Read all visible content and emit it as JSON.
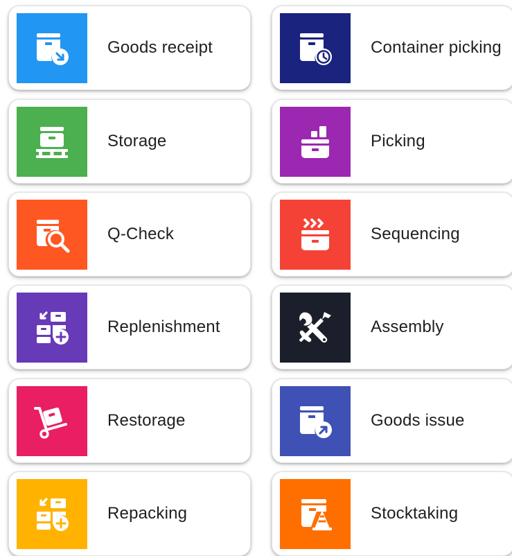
{
  "tiles": [
    {
      "label": "Goods receipt",
      "icon": "container-arrow-in-icon",
      "color": "#2196f3"
    },
    {
      "label": "Container picking",
      "icon": "container-clock-icon",
      "color": "#1a237e"
    },
    {
      "label": "Storage",
      "icon": "container-pallet-icon",
      "color": "#4caf50"
    },
    {
      "label": "Picking",
      "icon": "picking-boxes-icon",
      "color": "#9c27b0"
    },
    {
      "label": "Q-Check",
      "icon": "container-magnifier-icon",
      "color": "#ff5722"
    },
    {
      "label": "Sequencing",
      "icon": "container-chevrons-icon",
      "color": "#f44336"
    },
    {
      "label": "Replenishment",
      "icon": "boxes-plus-icon",
      "color": "#673ab7"
    },
    {
      "label": "Assembly",
      "icon": "wrench-screwdriver-icon",
      "color": "#1b1f2b"
    },
    {
      "label": "Restorage",
      "icon": "hand-truck-icon",
      "color": "#e91e63"
    },
    {
      "label": "Goods issue",
      "icon": "container-arrow-out-icon",
      "color": "#3f51b5"
    },
    {
      "label": "Repacking",
      "icon": "boxes-plus-icon",
      "color": "#ffb300"
    },
    {
      "label": "Stocktaking",
      "icon": "container-cone-icon",
      "color": "#ff6f00"
    }
  ]
}
